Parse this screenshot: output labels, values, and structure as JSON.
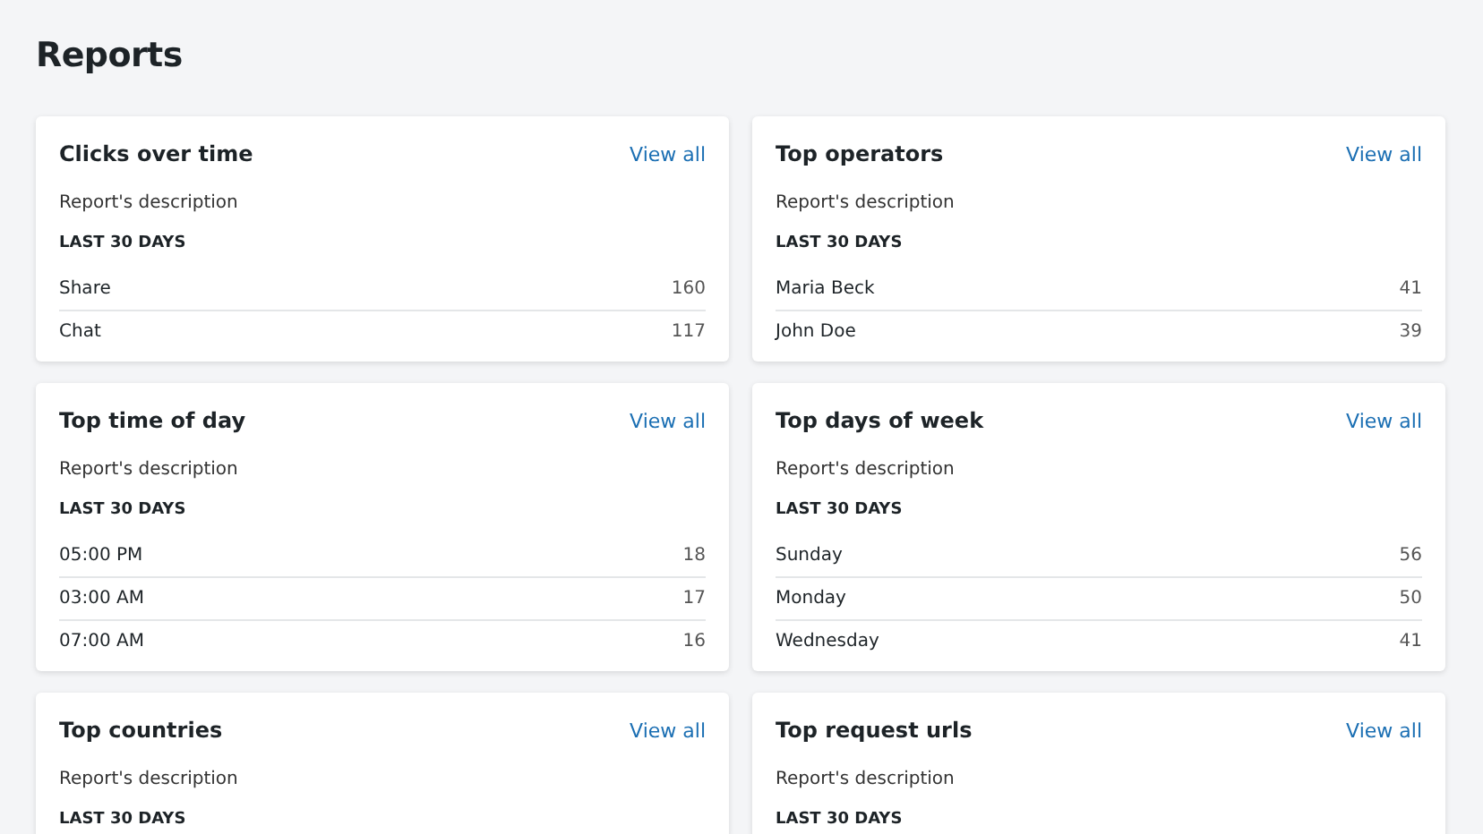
{
  "page_title": "Reports",
  "cards": [
    {
      "title": "Clicks over time",
      "link": "View all",
      "description": "Report's description",
      "period": "LAST 30 DAYS",
      "rows": [
        {
          "label": "Share",
          "value": "160"
        },
        {
          "label": "Chat",
          "value": "117"
        }
      ]
    },
    {
      "title": "Top operators",
      "link": "View all",
      "description": "Report's description",
      "period": "LAST 30 DAYS",
      "rows": [
        {
          "label": "Maria Beck",
          "value": "41"
        },
        {
          "label": "John Doe",
          "value": "39"
        }
      ]
    },
    {
      "title": "Top time of day",
      "link": "View all",
      "description": "Report's description",
      "period": "LAST 30 DAYS",
      "rows": [
        {
          "label": "05:00 PM",
          "value": "18"
        },
        {
          "label": "03:00 AM",
          "value": "17"
        },
        {
          "label": "07:00 AM",
          "value": "16"
        }
      ]
    },
    {
      "title": "Top days of week",
      "link": "View all",
      "description": "Report's description",
      "period": "LAST 30 DAYS",
      "rows": [
        {
          "label": "Sunday",
          "value": "56"
        },
        {
          "label": "Monday",
          "value": "50"
        },
        {
          "label": "Wednesday",
          "value": "41"
        }
      ]
    },
    {
      "title": "Top countries",
      "link": "View all",
      "description": "Report's description",
      "period": "LAST 30 DAYS"
    },
    {
      "title": "Top request urls",
      "link": "View all",
      "description": "Report's description",
      "period": "LAST 30 DAYS"
    }
  ]
}
